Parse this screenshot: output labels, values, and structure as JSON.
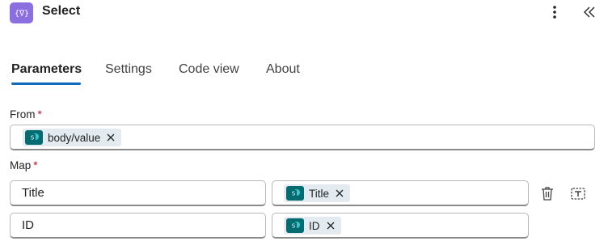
{
  "header": {
    "title": "Select",
    "action_icon": "select-action-icon",
    "more_icon": "more-vertical-icon",
    "collapse_icon": "double-chevron-left-icon",
    "accent": "#8b6fe0"
  },
  "tabs": [
    {
      "label": "Parameters",
      "active": true
    },
    {
      "label": "Settings",
      "active": false
    },
    {
      "label": "Code view",
      "active": false
    },
    {
      "label": "About",
      "active": false
    }
  ],
  "from": {
    "label": "From",
    "required_mark": "*",
    "token": {
      "label": "body/value",
      "icon": "sharepoint-icon"
    }
  },
  "map": {
    "label": "Map",
    "required_mark": "*",
    "rows": [
      {
        "key": "Title",
        "value_token": "Title",
        "token_icon": "sharepoint-icon"
      },
      {
        "key": "ID",
        "value_token": "ID",
        "token_icon": "sharepoint-icon"
      }
    ],
    "delete_icon": "trash-icon",
    "switch_mode_icon": "switch-to-text-mode-icon"
  },
  "colors": {
    "tab_accent": "#0f6cbd",
    "required": "#c50f1f",
    "sharepoint": "#036c70",
    "token_bg": "#e3ebf0"
  }
}
